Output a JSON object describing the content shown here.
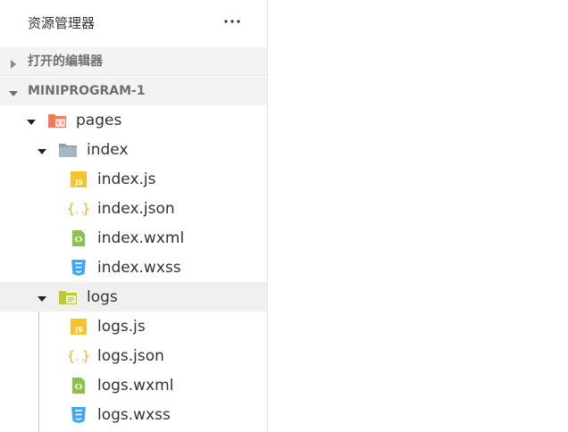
{
  "explorer": {
    "title": "资源管理器",
    "more_icon": "ellipsis-icon"
  },
  "sections": {
    "open_editors": {
      "label": "打开的编辑器",
      "expanded": false
    },
    "project": {
      "label": "MINIPROGRAM-1",
      "expanded": true
    }
  },
  "tree": {
    "pages": {
      "label": "pages",
      "icon": "pages-folder-icon",
      "expanded": true,
      "index": {
        "label": "index",
        "icon": "folder-icon",
        "expanded": true,
        "files": [
          {
            "label": "index.js",
            "icon": "js-file-icon"
          },
          {
            "label": "index.json",
            "icon": "json-file-icon"
          },
          {
            "label": "index.wxml",
            "icon": "wxml-file-icon"
          },
          {
            "label": "index.wxss",
            "icon": "wxss-file-icon"
          }
        ]
      },
      "logs": {
        "label": "logs",
        "icon": "folder-icon",
        "expanded": true,
        "highlighted": true,
        "files": [
          {
            "label": "logs.js",
            "icon": "js-file-icon"
          },
          {
            "label": "logs.json",
            "icon": "json-file-icon"
          },
          {
            "label": "logs.wxml",
            "icon": "wxml-file-icon"
          },
          {
            "label": "logs.wxss",
            "icon": "wxss-file-icon"
          }
        ]
      }
    }
  },
  "colors": {
    "js": "#f5c42c",
    "json": "#e6b422",
    "wxml": "#8bc34a",
    "wxss": "#42a5f5",
    "pages_folder": "#f07c5c",
    "index_folder": "#90a4ae",
    "logs_folder": "#c0ca33"
  }
}
